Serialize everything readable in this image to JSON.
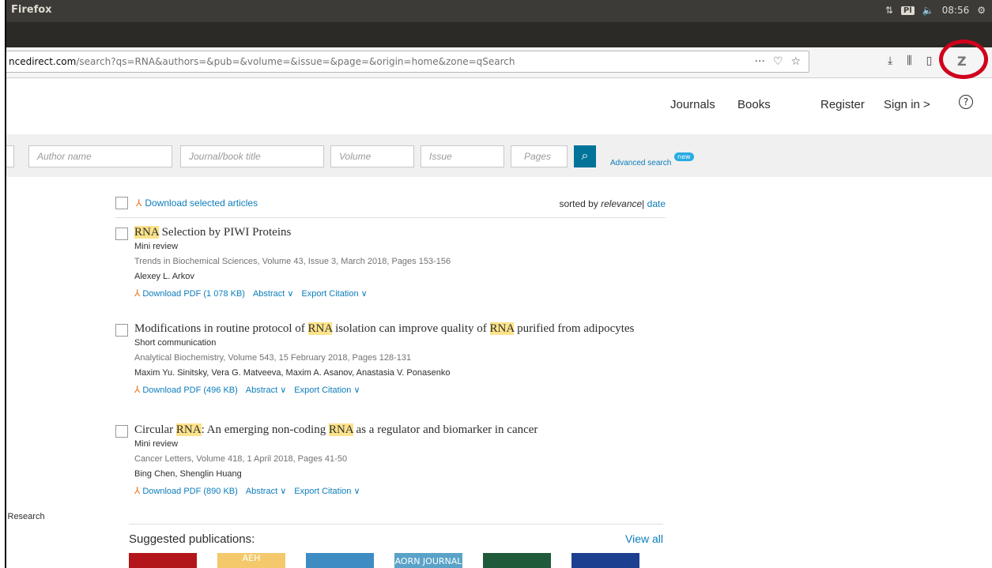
{
  "os_bar": {
    "app_title": "Firefox",
    "keyboard": "Pl",
    "time": "08:56"
  },
  "browser": {
    "url_host": "ncedirect.com",
    "url_path": "/search?qs=RNA&authors=&pub=&volume=&issue=&page=&origin=home&zone=qSearch",
    "zotero_label": "Z"
  },
  "site_nav": {
    "journals": "Journals",
    "books": "Books",
    "register": "Register",
    "sign_in": "Sign in",
    "sign_in_arrow": ">",
    "help": "?"
  },
  "search": {
    "author_placeholder": "Author name",
    "journal_placeholder": "Journal/book title",
    "volume_placeholder": "Volume",
    "issue_placeholder": "Issue",
    "pages_placeholder": "Pages",
    "advanced_label": "Advanced search",
    "new_badge": "new"
  },
  "results_header": {
    "download_selected": "Download selected articles",
    "sorted_by": "sorted by",
    "relevance": "relevance",
    "separator": "|",
    "date": "date"
  },
  "results": [
    {
      "title_parts": [
        "",
        "RNA",
        " Selection by PIWI Proteins",
        "",
        ""
      ],
      "type": "Mini review",
      "source": "Trends in Biochemical Sciences, Volume 43, Issue 3, March 2018, Pages 153-156",
      "authors": "Alexey L. Arkov",
      "pdf": "Download PDF (1 078 KB)",
      "abstract": "Abstract ∨",
      "export": "Export Citation ∨"
    },
    {
      "title_parts": [
        "Modifications in routine protocol of ",
        "RNA",
        " isolation can improve quality of ",
        "RNA",
        " purified from adipocytes"
      ],
      "type": "Short communication",
      "source": "Analytical Biochemistry, Volume 543, 15 February 2018, Pages 128-131",
      "authors": "Maxim Yu. Sinitsky, Vera G. Matveeva, Maxim A. Asanov, Anastasia V. Ponasenko",
      "pdf": "Download PDF (496 KB)",
      "abstract": "Abstract ∨",
      "export": "Export Citation ∨"
    },
    {
      "title_parts": [
        "Circular ",
        "RNA",
        ": An emerging non-coding ",
        "RNA",
        " as a regulator and biomarker in cancer"
      ],
      "type": "Mini review",
      "source": "Cancer Letters, Volume 418, 1 April 2018, Pages 41-50",
      "authors": "Bing Chen, Shenglin Huang",
      "pdf": "Download PDF (890 KB)",
      "abstract": "Abstract ∨",
      "export": "Export Citation ∨"
    }
  ],
  "sidebar_fragment": "l Research",
  "suggested": {
    "label": "Suggested publications:",
    "view_all": "View all",
    "cover_texts": [
      "",
      "AEH",
      "",
      "AORN JOURNAL",
      "",
      ""
    ]
  },
  "colors": {
    "accent": "#007398",
    "link": "#0c7dbb",
    "highlight": "#fce28a",
    "annotation_ring": "#d0021b"
  }
}
